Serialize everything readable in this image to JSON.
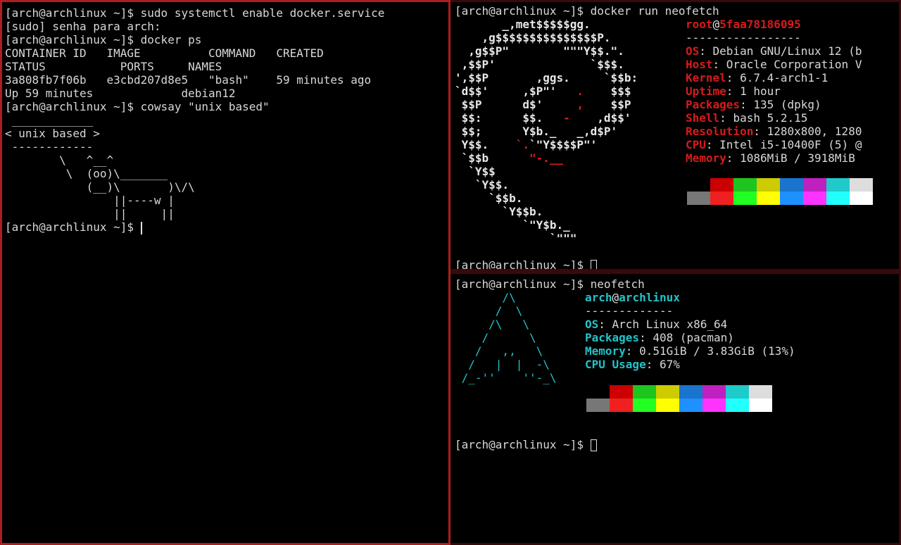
{
  "left_terminal": {
    "lines": [
      "[arch@archlinux ~]$ sudo systemctl enable docker.service",
      "[sudo] senha para arch:",
      "[arch@archlinux ~]$ docker ps",
      "CONTAINER ID   IMAGE          COMMAND   CREATED",
      "STATUS           PORTS     NAMES",
      "3a808fb7f06b   e3cbd207d8e5   \"bash\"    59 minutes ago",
      "Up 59 minutes             debian12",
      "[arch@archlinux ~]$ cowsay \"unix based\""
    ],
    "cowsay": " ____________\n< unix based >\n ------------\n        \\   ^__^\n         \\  (oo)\\_______\n            (__)\\       )\\/\\\n                ||----w |\n                ||     ||",
    "prompt": "[arch@archlinux ~]$ "
  },
  "top_right_terminal": {
    "command_line": "[arch@archlinux ~]$ docker run neofetch",
    "user": "root",
    "at": "@",
    "host": "5faa78186095",
    "separator": "-----------------",
    "info": [
      {
        "label": "OS",
        "value": ": Debian GNU/Linux 12 (b"
      },
      {
        "label": "Host",
        "value": ": Oracle Corporation V"
      },
      {
        "label": "Kernel",
        "value": ": 6.7.4-arch1-1"
      },
      {
        "label": "Uptime",
        "value": ": 1 hour"
      },
      {
        "label": "Packages",
        "value": ": 135 (dpkg)"
      },
      {
        "label": "Shell",
        "value": ": bash 5.2.15"
      },
      {
        "label": "Resolution",
        "value": ": 1280x800, 1280"
      },
      {
        "label": "CPU",
        "value": ": Intel i5-10400F (5) @"
      },
      {
        "label": "Memory",
        "value": ": 1086MiB / 3918MiB"
      }
    ],
    "prompt": "[arch@archlinux ~]$ "
  },
  "bottom_right_terminal": {
    "command_line": "[arch@archlinux ~]$ neofetch",
    "user": "arch",
    "at": "@",
    "host": "archlinux",
    "separator": "-------------",
    "info": [
      {
        "label": "OS",
        "value": ": Arch Linux x86_64"
      },
      {
        "label": "Packages",
        "value": ": 408 (pacman)"
      },
      {
        "label": "Memory",
        "value": ": 0.51GiB / 3.83GiB (13%)"
      },
      {
        "label": "CPU Usage",
        "value": ": 67%"
      }
    ],
    "prompt": "[arch@archlinux ~]$ "
  },
  "palette": {
    "top": [
      "#000000",
      "#cc0000",
      "#1ec51e",
      "#cccc00",
      "#1874cd",
      "#c020c0",
      "#1ecaca",
      "#dddddd"
    ],
    "bottom": [
      "#777777",
      "#f02020",
      "#22ff22",
      "#ffff00",
      "#1e90ff",
      "#ff33ff",
      "#22ffff",
      "#ffffff"
    ]
  }
}
